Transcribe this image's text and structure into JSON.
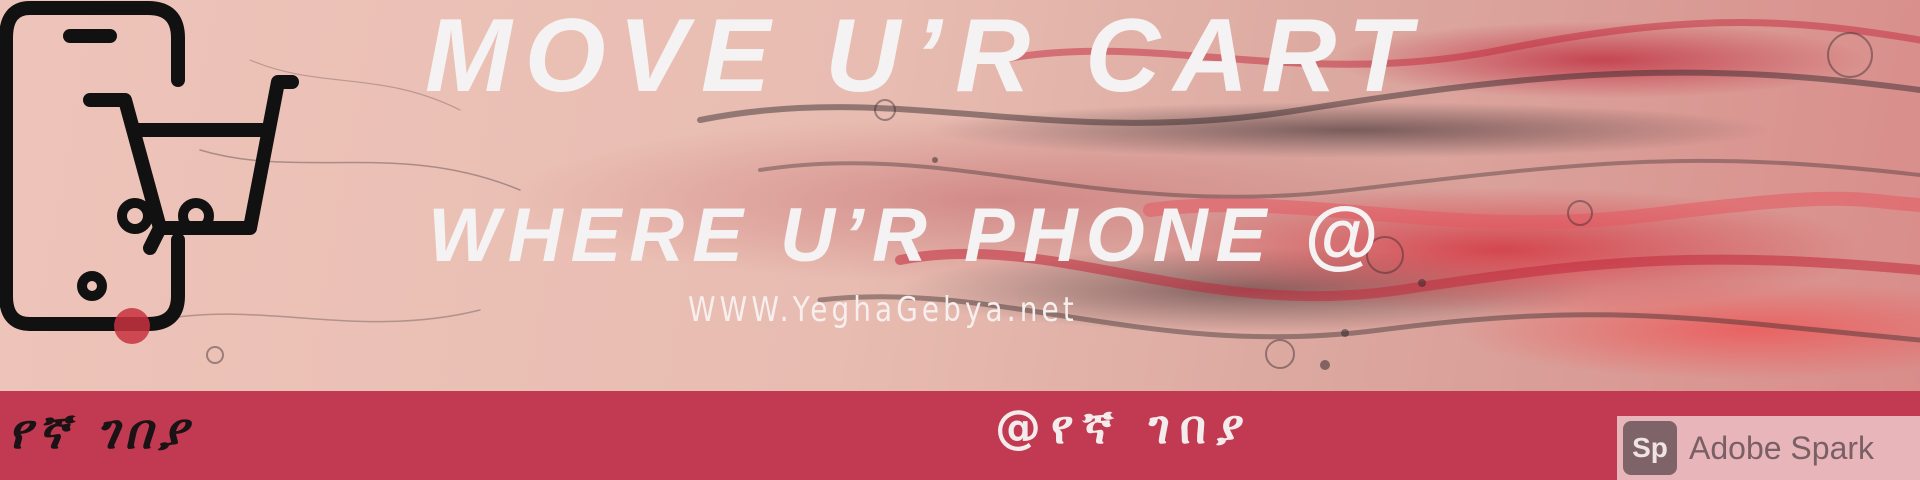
{
  "banner": {
    "title": "MOVE U’R CART",
    "subtitle": "WHERE U’R PHONE @",
    "website": "WWW.YeghaGebya.net"
  },
  "footer": {
    "brand_left": "የኛ ገበያ",
    "brand_center": "@የኛ ገበያ",
    "badge": {
      "icon_text": "Sp",
      "label": "Adobe Spark"
    }
  },
  "colors": {
    "band": "#c13a51",
    "text_light": "#f4f2f2",
    "logo": "#111111",
    "marble_base": "#e8bcb1",
    "marble_red": "#d33642"
  },
  "icons": [
    "phone-cart-logo-icon"
  ]
}
